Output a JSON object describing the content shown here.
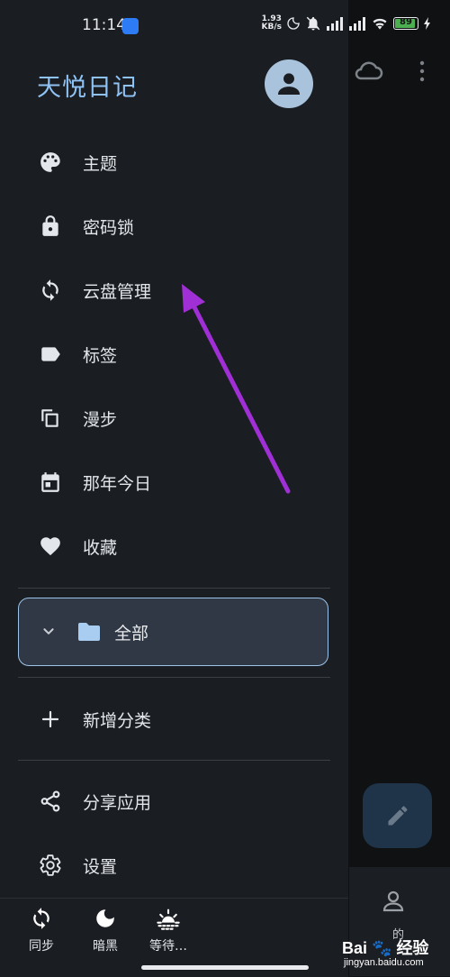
{
  "status_bar": {
    "time": "11:14",
    "speed_top": "1.93",
    "speed_bottom": "KB/s",
    "battery": "89"
  },
  "drawer": {
    "app_title": "天悦日记",
    "menu": [
      {
        "label": "主题",
        "icon": "palette-icon"
      },
      {
        "label": "密码锁",
        "icon": "lock-icon"
      },
      {
        "label": "云盘管理",
        "icon": "sync-icon"
      },
      {
        "label": "标签",
        "icon": "label-icon"
      },
      {
        "label": "漫步",
        "icon": "copy-icon"
      },
      {
        "label": "那年今日",
        "icon": "calendar-icon"
      },
      {
        "label": "收藏",
        "icon": "heart-icon"
      }
    ],
    "folder": {
      "label": "全部"
    },
    "add_category": "新增分类",
    "share_app": "分享应用",
    "settings": "设置"
  },
  "bottom_bar": {
    "items": [
      {
        "label": "同步",
        "icon": "sync-icon"
      },
      {
        "label": "暗黑",
        "icon": "moon-icon"
      },
      {
        "label": "等待…",
        "icon": "sunrise-icon"
      }
    ]
  },
  "background": {
    "bottom_label": "的"
  },
  "watermark": {
    "brand": "Bai",
    "brand_cn": "经验",
    "url": "jingyan.baidu.com"
  },
  "colors": {
    "drawer_bg": "#1a1d21",
    "accent": "#8fc3f5",
    "annotation_arrow": "#a12fd6"
  }
}
